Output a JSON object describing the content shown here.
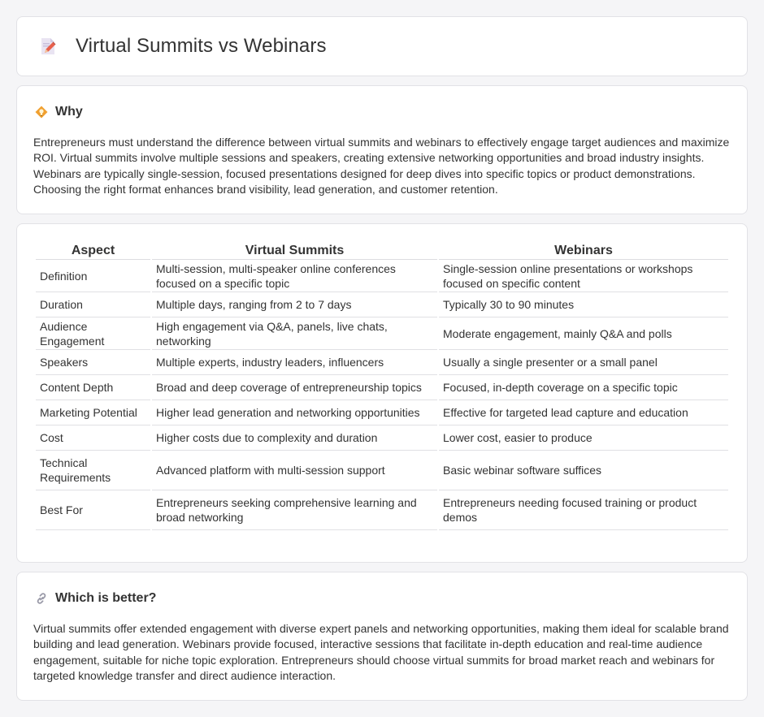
{
  "header": {
    "title": "Virtual Summits vs Webinars",
    "icon": "document-pencil-icon"
  },
  "why": {
    "icon": "lightbulb-diamond-icon",
    "title": "Why",
    "text": "Entrepreneurs must understand the difference between virtual summits and webinars to effectively engage target audiences and maximize ROI. Virtual summits involve multiple sessions and speakers, creating extensive networking opportunities and broad industry insights. Webinars are typically single-session, focused presentations designed for deep dives into specific topics or product demonstrations. Choosing the right format enhances brand visibility, lead generation, and customer retention."
  },
  "table": {
    "headers": [
      "Aspect",
      "Virtual Summits",
      "Webinars"
    ],
    "rows": [
      [
        "Definition",
        "Multi-session, multi-speaker online conferences focused on a specific topic",
        "Single-session online presentations or workshops focused on specific content"
      ],
      [
        "Duration",
        "Multiple days, ranging from 2 to 7 days",
        "Typically 30 to 90 minutes"
      ],
      [
        "Audience Engagement",
        "High engagement via Q&A, panels, live chats, networking",
        "Moderate engagement, mainly Q&A and polls"
      ],
      [
        "Speakers",
        "Multiple experts, industry leaders, influencers",
        "Usually a single presenter or a small panel"
      ],
      [
        "Content Depth",
        "Broad and deep coverage of entrepreneurship topics",
        "Focused, in-depth coverage on a specific topic"
      ],
      [
        "Marketing Potential",
        "Higher lead generation and networking opportunities",
        "Effective for targeted lead capture and education"
      ],
      [
        "Cost",
        "Higher costs due to complexity and duration",
        "Lower cost, easier to produce"
      ],
      [
        "Technical Requirements",
        "Advanced platform with multi-session support",
        "Basic webinar software suffices"
      ],
      [
        "Best For",
        "Entrepreneurs seeking comprehensive learning and broad networking",
        "Entrepreneurs needing focused training or product demos"
      ]
    ]
  },
  "better": {
    "icon": "link-icon",
    "title": "Which is better?",
    "text": "Virtual summits offer extended engagement with diverse expert panels and networking opportunities, making them ideal for scalable brand building and lead generation. Webinars provide focused, interactive sessions that facilitate in-depth education and real-time audience engagement, suitable for niche topic exploration. Entrepreneurs should choose virtual summits for broad market reach and webinars for targeted knowledge transfer and direct audience interaction."
  },
  "colors": {
    "accent_orange": "#f0a030",
    "pencil_red": "#e8604c",
    "page_bg": "#f5f5f7",
    "border": "#e2e2e6"
  }
}
